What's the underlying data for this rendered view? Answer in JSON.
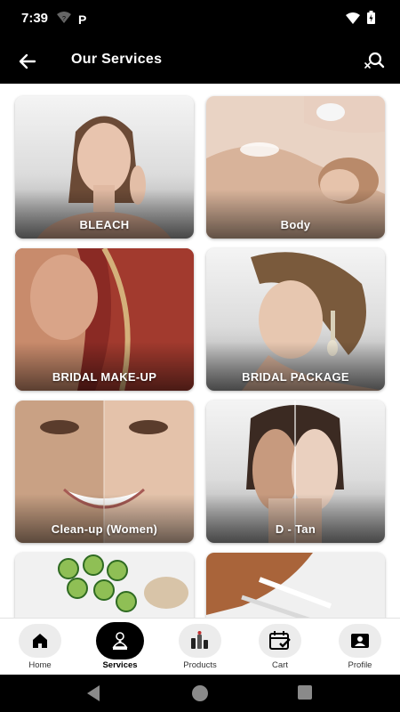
{
  "status_bar": {
    "time": "7:39",
    "badge": "P",
    "icons": [
      "wifi-question-icon",
      "wifi-icon",
      "battery-icon"
    ]
  },
  "header": {
    "title": "Our Services",
    "back_icon": "arrow-left-icon",
    "search_icon": "search-clear-icon"
  },
  "services": [
    {
      "label": "BLEACH",
      "image": "face-portrait"
    },
    {
      "label": "Body",
      "image": "body-massage"
    },
    {
      "label": "BRIDAL MAKE-UP",
      "image": "bride-veil"
    },
    {
      "label": "BRIDAL PACKAGE",
      "image": "bridal-hairstyle"
    },
    {
      "label": "Clean-up (Women)",
      "image": "face-split"
    },
    {
      "label": "D - Tan",
      "image": "face-split-tan"
    },
    {
      "label": "",
      "image": "cucumber-slices"
    },
    {
      "label": "",
      "image": "hair-coloring"
    }
  ],
  "bottom_nav": {
    "items": [
      {
        "label": "Home",
        "icon": "home-icon",
        "active": false
      },
      {
        "label": "Services",
        "icon": "services-icon",
        "active": true
      },
      {
        "label": "Products",
        "icon": "products-icon",
        "active": false
      },
      {
        "label": "Cart",
        "icon": "cart-icon",
        "active": false
      },
      {
        "label": "Profile",
        "icon": "profile-icon",
        "active": false
      }
    ]
  },
  "system_nav": {
    "icons": [
      "back-triangle-icon",
      "home-circle-icon",
      "recents-square-icon"
    ]
  },
  "colors": {
    "bar": "#000000",
    "content_bg": "#ffffff",
    "accent": "#000000",
    "nav_circle": "#ececec"
  }
}
